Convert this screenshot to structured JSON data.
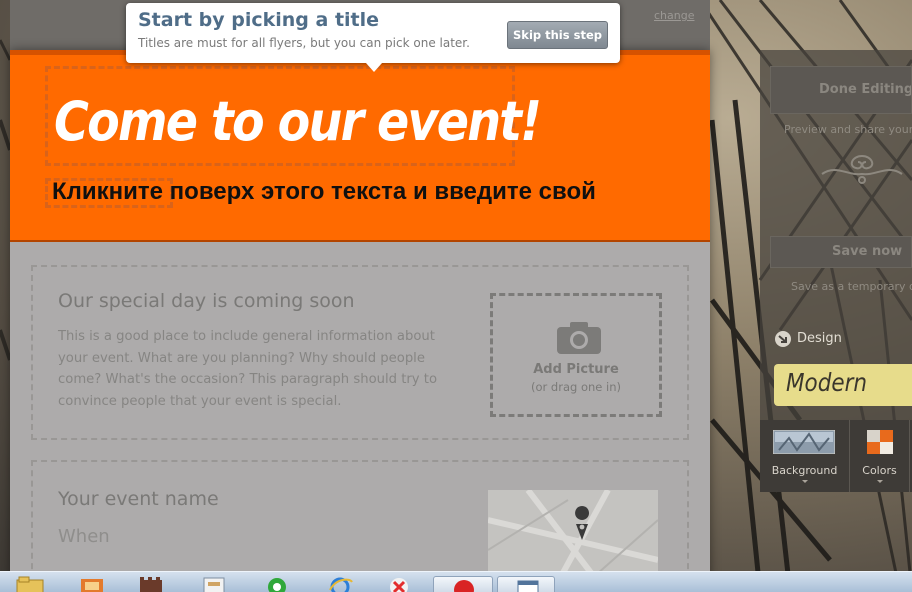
{
  "tooltip": {
    "title": "Start by picking a title",
    "text": "Titles are must for all flyers, but you can pick one later.",
    "skip_label": "Skip this step"
  },
  "top_bar": {
    "change_link": "change"
  },
  "flyer": {
    "title": "Come to our event!",
    "subtitle_overlay": "Кликните поверх этого текста и введите свой",
    "header_color": "#ff6a00",
    "section1": {
      "heading": "Our special day is coming soon",
      "paragraph_lines": [
        "This is a good place to include general information about",
        "your event. What are you planning? Why should people",
        "come? What's the occasion? This paragraph should try to",
        "convince people that your event is special."
      ],
      "picture_label": "Add Picture",
      "picture_hint": "(or drag one in)"
    },
    "section2": {
      "heading": "Your event name",
      "when_label": "When"
    }
  },
  "side_panel": {
    "done_label": "Done Editing",
    "preview_hint": "Preview and share your",
    "save_label": "Save now",
    "save_hint": "Save as a temporary d",
    "design_label": "Design",
    "theme_name": "Modern",
    "theme_color": "#e7dc8b",
    "tools": [
      {
        "label": "Background",
        "icon": "background-swatch-icon"
      },
      {
        "label": "Colors",
        "icon": "color-palette-icon"
      }
    ]
  },
  "taskbar": {
    "icons": [
      "folder-icon",
      "media-icon",
      "castle-icon",
      "document-icon",
      "messenger-icon",
      "ie-icon",
      "yandex-icon",
      "opera-icon",
      "window-icon"
    ]
  }
}
